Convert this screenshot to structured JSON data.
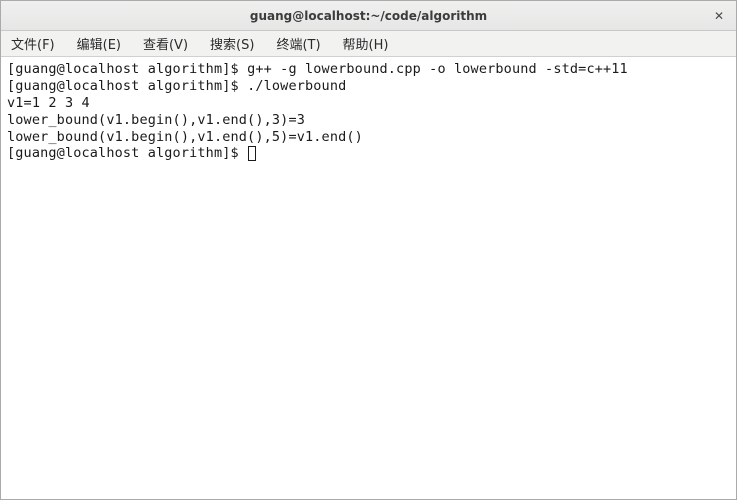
{
  "window": {
    "title": "guang@localhost:~/code/algorithm"
  },
  "menubar": {
    "items": [
      "文件(F)",
      "编辑(E)",
      "查看(V)",
      "搜索(S)",
      "终端(T)",
      "帮助(H)"
    ]
  },
  "terminal": {
    "lines": [
      {
        "prompt": "[guang@localhost algorithm]$ ",
        "cmd": "g++ -g lowerbound.cpp -o lowerbound -std=c++11"
      },
      {
        "prompt": "[guang@localhost algorithm]$ ",
        "cmd": "./lowerbound"
      },
      {
        "out": "v1=1 2 3 4 "
      },
      {
        "out": "lower_bound(v1.begin(),v1.end(),3)=3"
      },
      {
        "out": "lower_bound(v1.begin(),v1.end(),5)=v1.end()"
      },
      {
        "prompt": "[guang@localhost algorithm]$ ",
        "cursor": true
      }
    ]
  }
}
